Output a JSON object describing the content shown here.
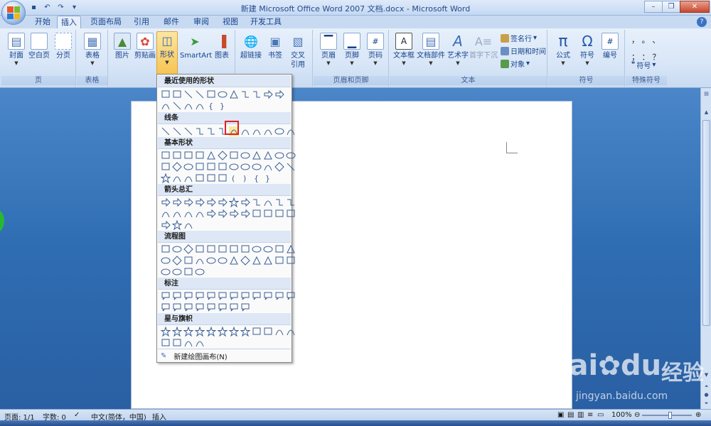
{
  "window": {
    "title": "新建 Microsoft Office Word 2007 文档.docx - Microsoft Word"
  },
  "tabs": [
    "开始",
    "插入",
    "页面布局",
    "引用",
    "邮件",
    "审阅",
    "视图",
    "开发工具"
  ],
  "ribbon": {
    "groups": {
      "page": {
        "label": "页",
        "buttons": [
          "封面",
          "空白页",
          "分页"
        ]
      },
      "table": {
        "label": "表格",
        "buttons": [
          "表格"
        ]
      },
      "illustrations": {
        "buttons": [
          "图片",
          "剪贴画",
          "形状",
          "SmartArt",
          "图表"
        ]
      },
      "links": {
        "buttons": [
          "超链接",
          "书签",
          "交叉",
          "引用"
        ]
      },
      "header_footer": {
        "label": "页眉和页脚",
        "buttons": [
          "页眉",
          "页脚",
          "页码"
        ]
      },
      "text": {
        "label": "文本",
        "buttons": [
          "文本框",
          "文档部件",
          "艺术字",
          "首字下沉"
        ],
        "small": [
          "签名行",
          "日期和时间",
          "对象"
        ]
      },
      "symbols": {
        "label": "符号",
        "buttons": [
          "公式",
          "符号",
          "编号"
        ]
      },
      "special": {
        "label": "特殊符号",
        "small_label": "符号",
        "chars": [
          "，",
          "。",
          "、",
          "；",
          "：",
          "？"
        ]
      }
    }
  },
  "shapes_menu": {
    "sections": [
      "最近使用的形状",
      "线条",
      "基本形状",
      "箭头总汇",
      "流程图",
      "标注",
      "星与旗帜"
    ],
    "footer": "新建绘图画布(N)"
  },
  "status": {
    "page": "页面: 1/1",
    "words": "字数: 0",
    "language": "中文(简体，中国)",
    "mode": "插入",
    "zoom": "100%"
  },
  "watermark": {
    "brand": "Bai",
    "brand2": "du",
    "text": "经验",
    "url": "jingyan.baidu.com"
  }
}
